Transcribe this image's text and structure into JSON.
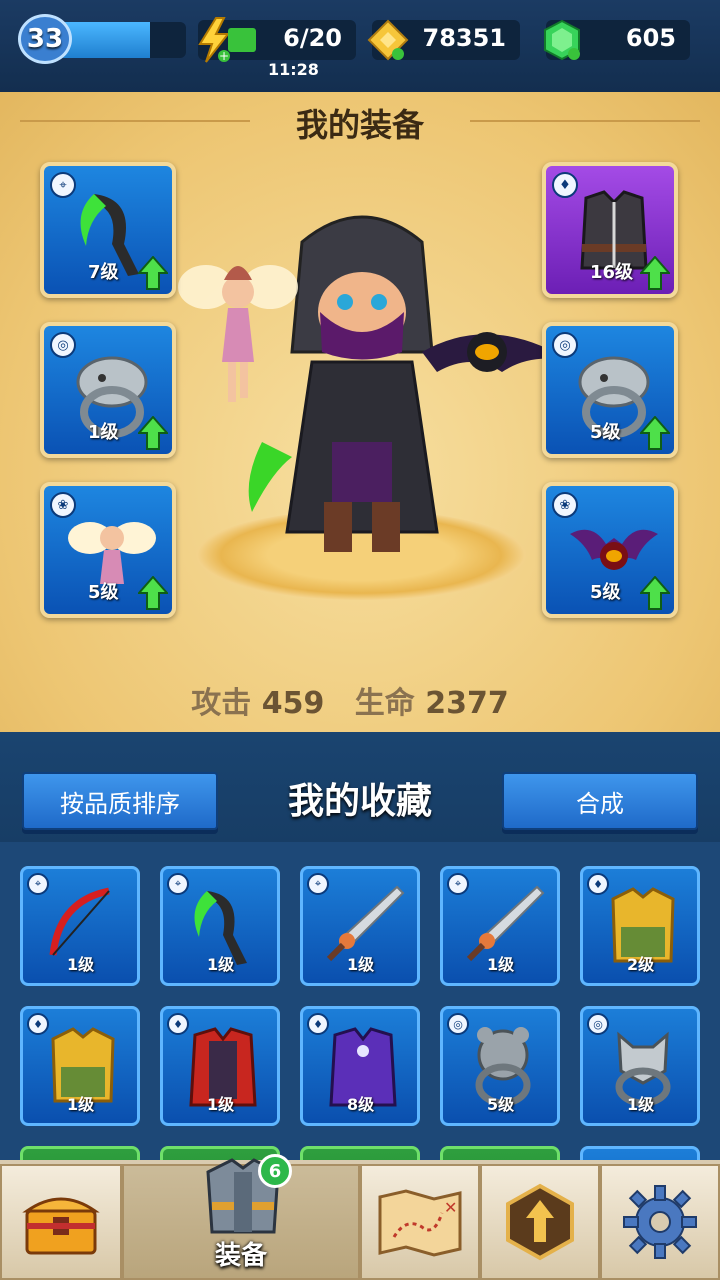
{
  "player": {
    "level": "33",
    "xp_fraction": 0.72
  },
  "resources": {
    "energy": {
      "value": "6/20",
      "timer": "11:28",
      "icon": "lightning-icon"
    },
    "gold": {
      "value": "78351",
      "icon": "gold-wings-icon"
    },
    "gems": {
      "value": "605",
      "icon": "green-gem-icon"
    }
  },
  "equipment": {
    "title": "我的装备",
    "slots": [
      {
        "type": "weapon-bow-icon",
        "item": "green-scythe",
        "level": "7级",
        "rarity": "blue",
        "upgradable": true
      },
      {
        "type": "armor-icon",
        "item": "dark-tunic",
        "level": "16级",
        "rarity": "purple",
        "upgradable": true
      },
      {
        "type": "ring-icon",
        "item": "serpent-ring",
        "level": "1级",
        "rarity": "blue",
        "upgradable": true
      },
      {
        "type": "ring-icon",
        "item": "serpent-ring",
        "level": "5级",
        "rarity": "blue",
        "upgradable": true
      },
      {
        "type": "pet-paw-icon",
        "item": "fairy",
        "level": "5级",
        "rarity": "blue",
        "upgradable": true
      },
      {
        "type": "pet-paw-icon",
        "item": "bat",
        "level": "5级",
        "rarity": "blue",
        "upgradable": true
      }
    ],
    "stats": {
      "attack_label": "攻击",
      "attack_value": "459",
      "hp_label": "生命",
      "hp_value": "2377"
    }
  },
  "collection": {
    "title": "我的收藏",
    "sort_button": "按品质排序",
    "merge_button": "合成",
    "items": [
      {
        "type": "weapon-bow-icon",
        "item": "red-bow",
        "level": "1级"
      },
      {
        "type": "weapon-bow-icon",
        "item": "green-scythe",
        "level": "1级"
      },
      {
        "type": "weapon-bow-icon",
        "item": "sword",
        "level": "1级"
      },
      {
        "type": "weapon-bow-icon",
        "item": "sword",
        "level": "1级"
      },
      {
        "type": "armor-icon",
        "item": "golden-armor",
        "level": "2级"
      },
      {
        "type": "armor-icon",
        "item": "golden-armor",
        "level": "1级"
      },
      {
        "type": "armor-icon",
        "item": "red-robe",
        "level": "1级"
      },
      {
        "type": "armor-icon",
        "item": "purple-robe",
        "level": "8级"
      },
      {
        "type": "ring-icon",
        "item": "bear-ring",
        "level": "5级"
      },
      {
        "type": "ring-icon",
        "item": "wolf-ring",
        "level": "1级"
      }
    ]
  },
  "nav": {
    "tabs": [
      {
        "icon": "treasure-chest-icon",
        "label": ""
      },
      {
        "icon": "armor-helmet-icon",
        "label": "装备",
        "badge": "6",
        "active": true
      },
      {
        "icon": "map-icon",
        "label": ""
      },
      {
        "icon": "upgrade-arrow-icon",
        "label": ""
      },
      {
        "icon": "gear-icon",
        "label": ""
      }
    ]
  },
  "colors": {
    "energy": "#39c23b",
    "xp": "#3aa6f5",
    "panel": "#edc673",
    "slot_blue": "#1670d0",
    "slot_purple": "#8f36d6"
  }
}
